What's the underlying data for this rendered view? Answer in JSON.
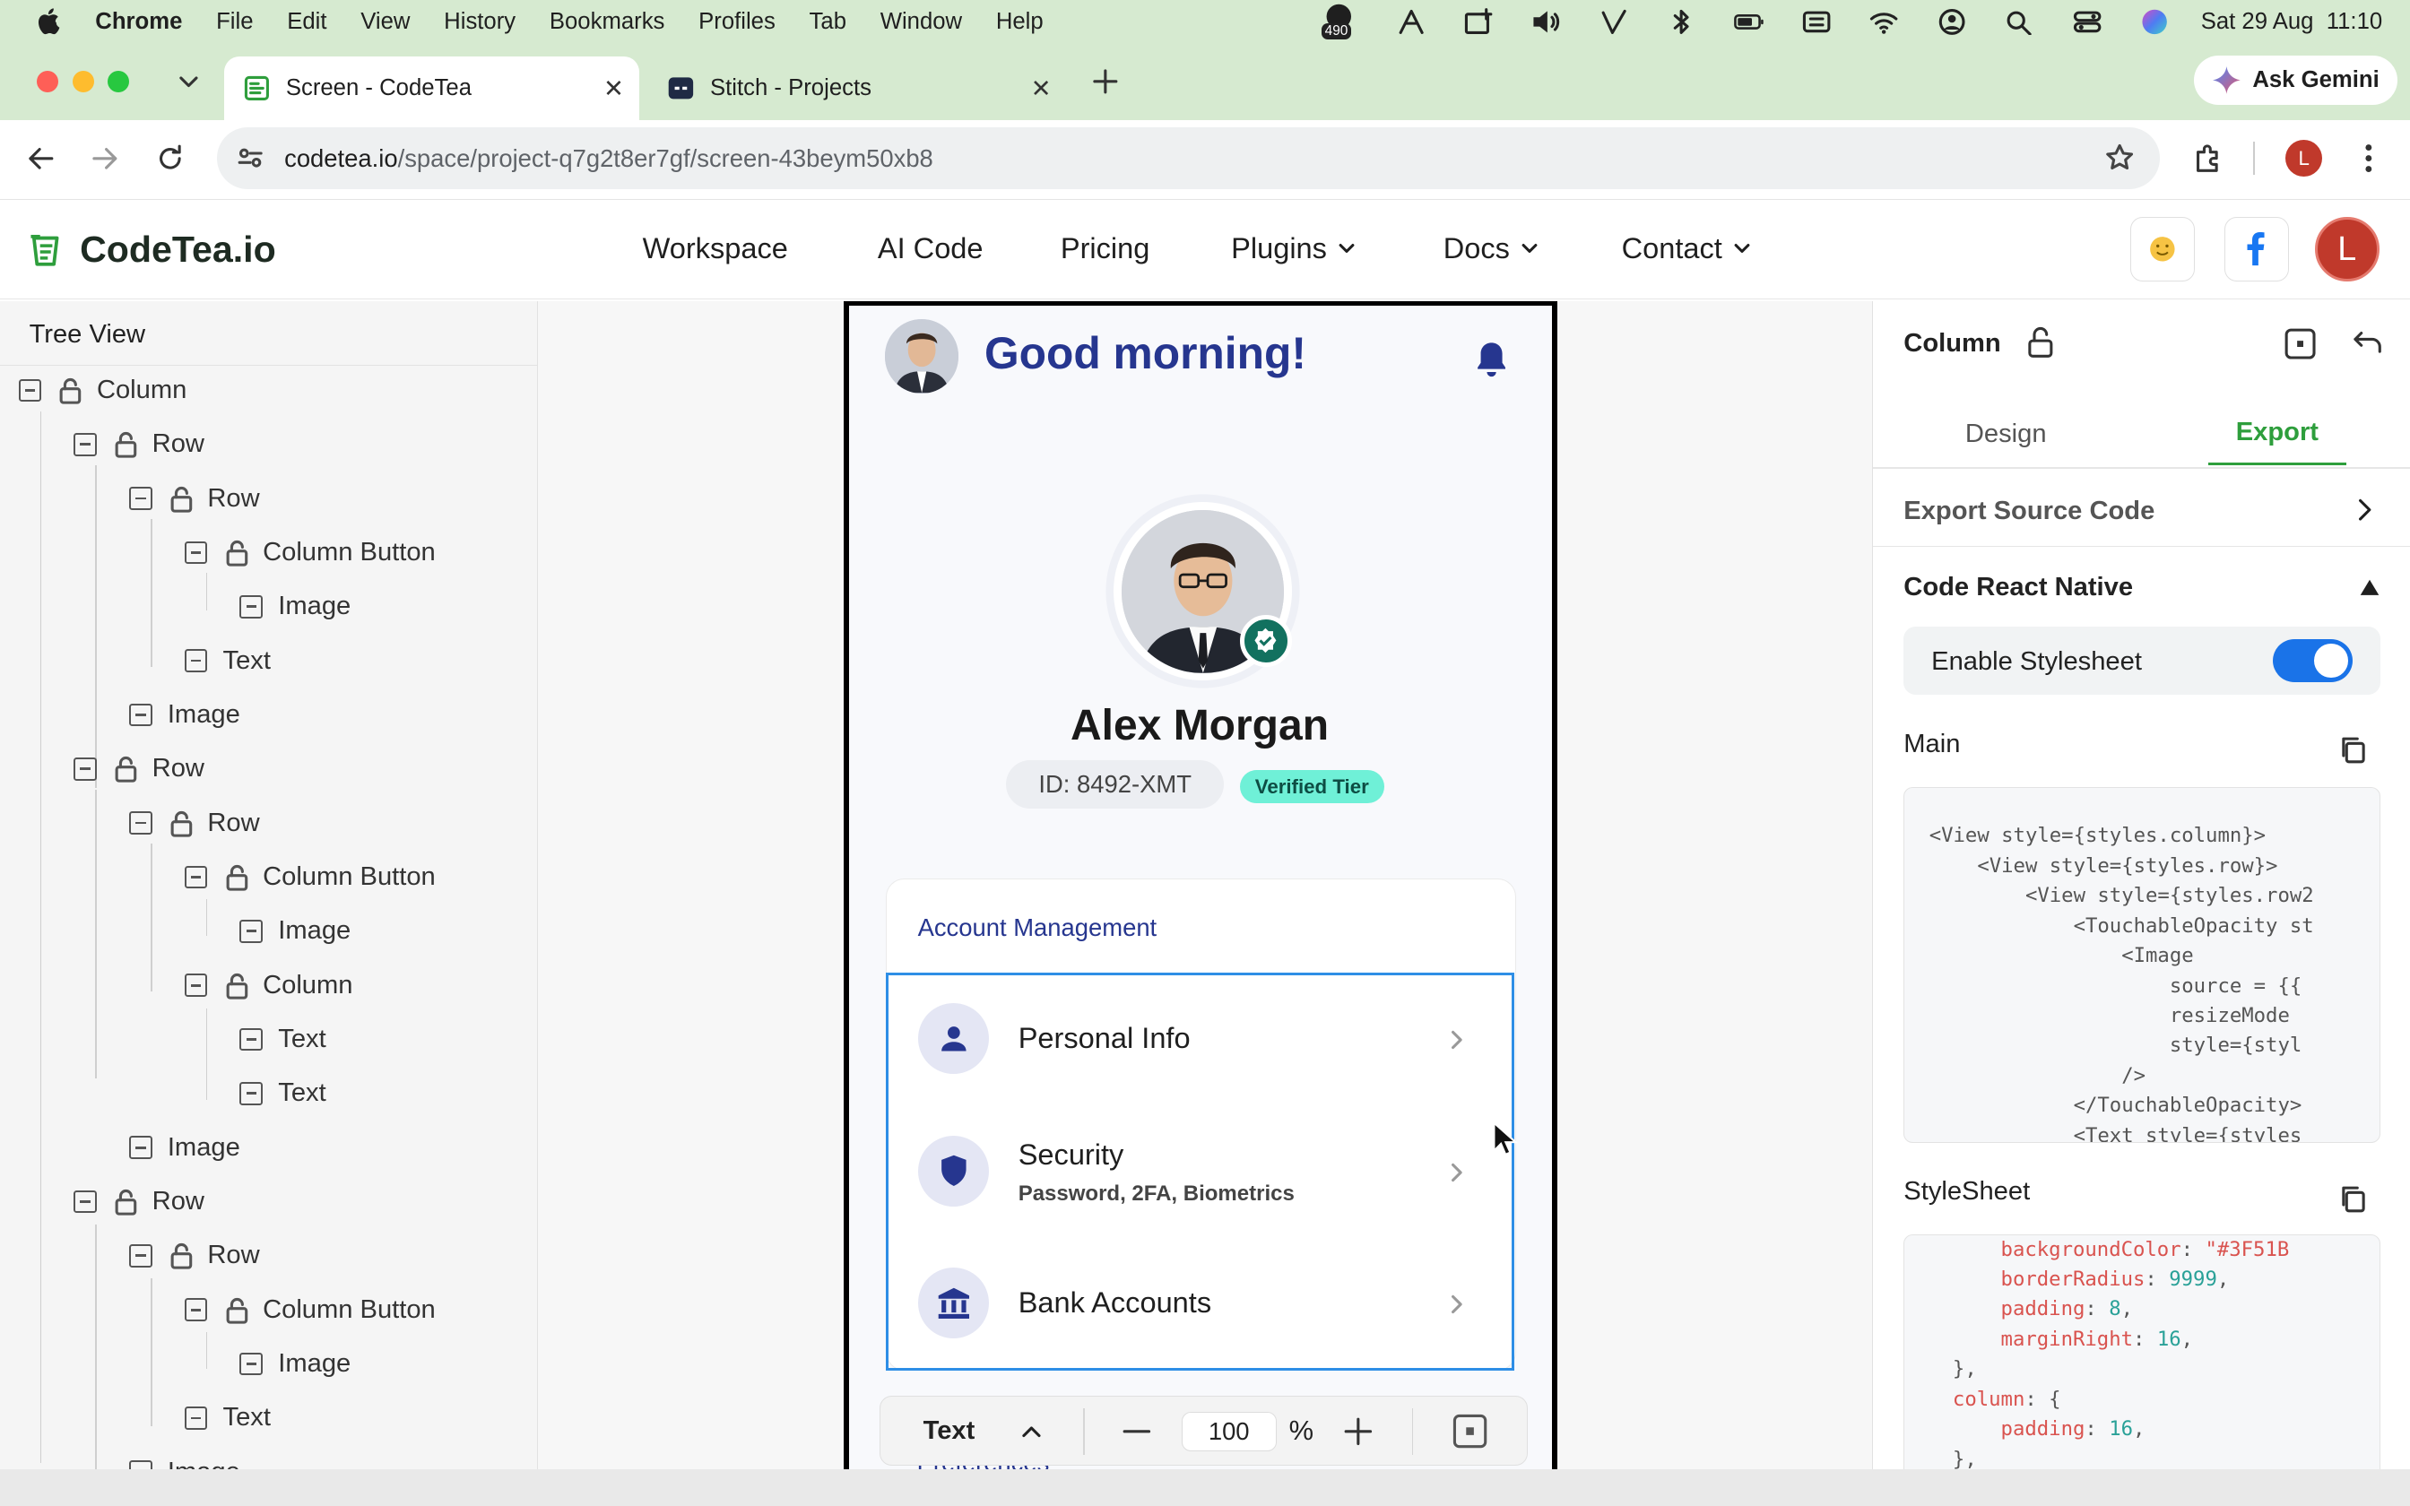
{
  "menubar": {
    "app": "Chrome",
    "items": [
      "File",
      "Edit",
      "View",
      "History",
      "Bookmarks",
      "Profiles",
      "Tab",
      "Window",
      "Help"
    ],
    "badge": "490",
    "datetime": "Sat 29 Aug  11:10"
  },
  "tabs": [
    {
      "title": "Screen - CodeTea",
      "active": true
    },
    {
      "title": "Stitch - Projects",
      "active": false
    }
  ],
  "gemini_label": "Ask Gemini",
  "address": {
    "host": "codetea.io",
    "path": "/space/project-q7g2t8er7gf/screen-43beym50xb8"
  },
  "profile_initial": "L",
  "site": {
    "logo": "CodeTea.io",
    "nav": [
      "Workspace",
      "AI Code",
      "Pricing",
      "Plugins",
      "Docs",
      "Contact"
    ],
    "avatar_initial": "L"
  },
  "tree": {
    "title": "Tree View",
    "nodes": [
      {
        "label": "Column"
      },
      {
        "label": "Row"
      },
      {
        "label": "Row"
      },
      {
        "label": "Column Button"
      },
      {
        "label": "Image"
      },
      {
        "label": "Text"
      },
      {
        "label": "Image"
      },
      {
        "label": "Row"
      },
      {
        "label": "Row"
      },
      {
        "label": "Column Button"
      },
      {
        "label": "Image"
      },
      {
        "label": "Column"
      },
      {
        "label": "Text"
      },
      {
        "label": "Text"
      },
      {
        "label": "Image"
      },
      {
        "label": "Row"
      },
      {
        "label": "Row"
      },
      {
        "label": "Column Button"
      },
      {
        "label": "Image"
      },
      {
        "label": "Text"
      },
      {
        "label": "Image"
      }
    ]
  },
  "phone": {
    "greeting": "Good morning!",
    "name": "Alex Morgan",
    "id": "ID: 8492-XMT",
    "tier": "Verified Tier",
    "section_title": "Account Management",
    "items": [
      {
        "label": "Personal Info",
        "sub": "",
        "icon": "person-icon"
      },
      {
        "label": "Security",
        "sub": "Password, 2FA, Biometrics",
        "icon": "shield-icon"
      },
      {
        "label": "Bank Accounts",
        "sub": "",
        "icon": "bank-icon"
      }
    ],
    "next_section_partial": "Preferences"
  },
  "canvas_toolbar": {
    "element": "Text",
    "zoom": "100",
    "unit": "%"
  },
  "panel": {
    "title": "Column",
    "tabs": [
      "Design",
      "Export"
    ],
    "active_tab": "Export",
    "export_source": "Export Source Code",
    "code_section": "Code React Native",
    "toggle_label": "Enable Stylesheet",
    "toggle_on": true,
    "main_label": "Main",
    "main_code": [
      "<View style={styles.column}>",
      "    <View style={styles.row}>",
      "        <View style={styles.row2",
      "            <TouchableOpacity st",
      "                <Image",
      "                    source = {{",
      "                    resizeMode",
      "                    style={styl",
      "                />",
      "            </TouchableOpacity>",
      "            <Text style={styles"
    ],
    "stylesheet_label": "StyleSheet",
    "stylesheet_code": [
      {
        "indent": "        ",
        "key": "backgroundColor",
        "val": "\"#3F51B",
        "type": "str"
      },
      {
        "indent": "        ",
        "key": "borderRadius",
        "val": "9999",
        "type": "num"
      },
      {
        "indent": "        ",
        "key": "padding",
        "val": "8",
        "type": "num"
      },
      {
        "indent": "        ",
        "key": "marginRight",
        "val": "16",
        "type": "num"
      },
      {
        "indent": "    ",
        "key": "}",
        "val": "",
        "type": "brace"
      },
      {
        "indent": "    ",
        "key": "column",
        "val": "{",
        "type": "obj"
      },
      {
        "indent": "        ",
        "key": "padding",
        "val": "16",
        "type": "num"
      },
      {
        "indent": "    ",
        "key": "}",
        "val": "",
        "type": "brace"
      }
    ]
  },
  "colors": {
    "chrome_bg": "#d6ead0",
    "brand_green": "#2e9e3c",
    "heading_blue": "#26368f",
    "selection_blue": "#2e8ee6",
    "tier_bg": "#6ff0d7",
    "toggle_blue": "#1a73e8"
  }
}
